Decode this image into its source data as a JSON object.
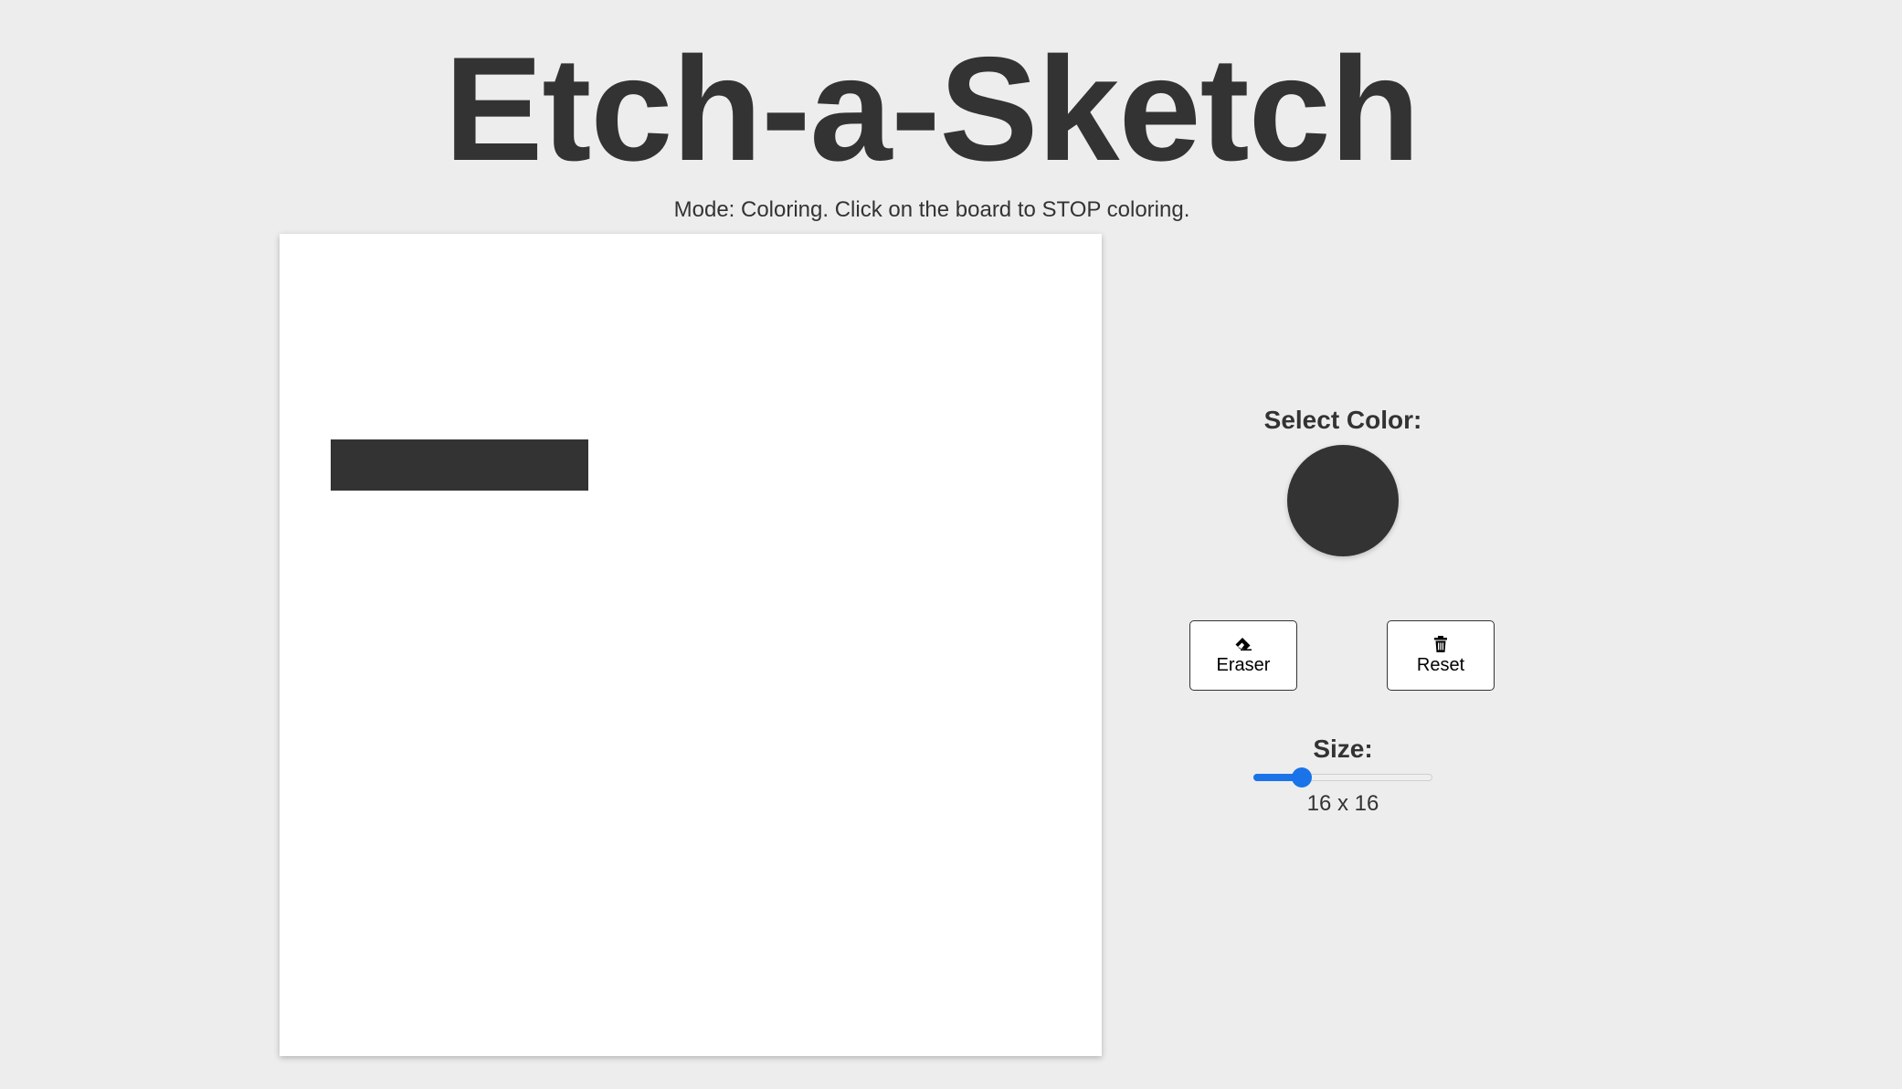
{
  "header": {
    "title": "Etch-a-Sketch",
    "mode_text": "Mode: Coloring. Click on the board to STOP coloring."
  },
  "board": {
    "grid_size": 16,
    "filled_cells": [
      {
        "row": 4,
        "col": 1
      },
      {
        "row": 4,
        "col": 2
      },
      {
        "row": 4,
        "col": 3
      },
      {
        "row": 4,
        "col": 4
      },
      {
        "row": 4,
        "col": 5
      }
    ],
    "fill_color": "#333333",
    "background_color": "#ffffff"
  },
  "controls": {
    "color_label": "Select Color:",
    "selected_color": "#333333",
    "eraser": {
      "label": "Eraser",
      "icon": "eraser-icon"
    },
    "reset": {
      "label": "Reset",
      "icon": "trash-icon"
    },
    "size": {
      "label": "Size:",
      "value_text": "16 x 16",
      "slider_fraction": 0.27,
      "accent_color": "#1a73e8"
    }
  }
}
